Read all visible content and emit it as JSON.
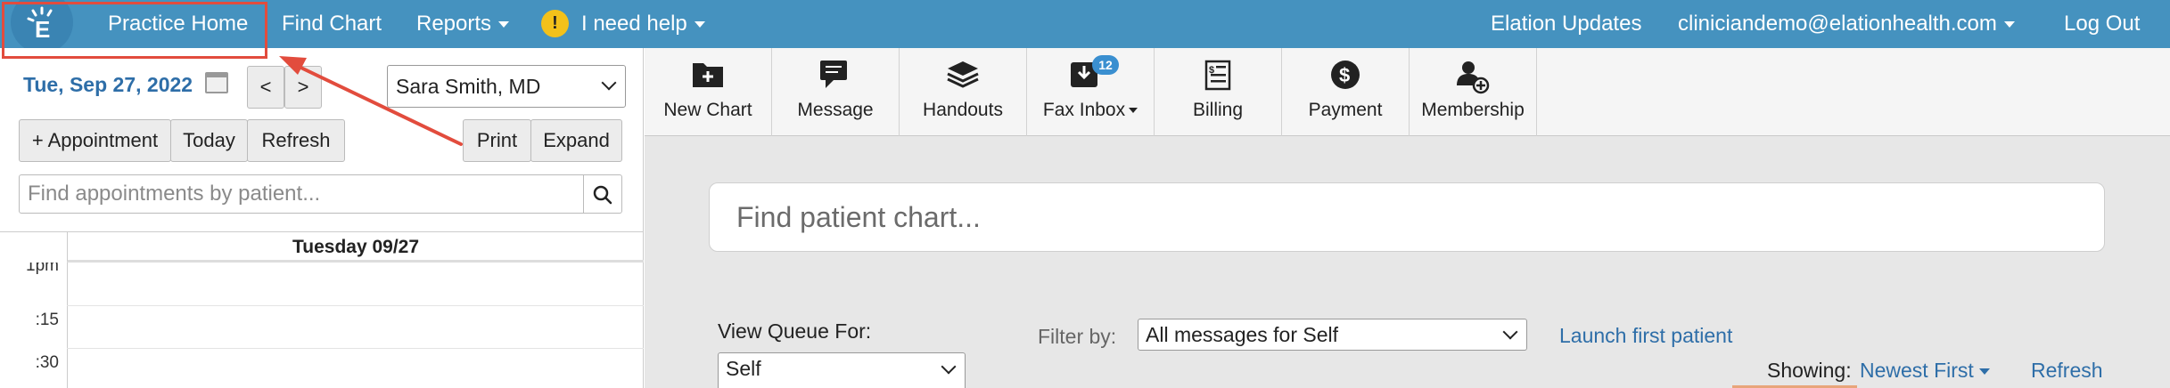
{
  "topnav": {
    "practice_home": "Practice Home",
    "find_chart": "Find Chart",
    "reports": "Reports",
    "help": "I need help",
    "updates": "Elation Updates",
    "user_email": "cliniciandemo@elationhealth.com",
    "logout": "Log Out"
  },
  "calendar": {
    "date": "Tue, Sep 27, 2022",
    "prev": "<",
    "next": ">",
    "provider": "Sara Smith, MD",
    "add_appointment": "+ Appointment",
    "today": "Today",
    "refresh": "Refresh",
    "print": "Print",
    "expand": "Expand",
    "search_placeholder": "Find appointments by patient...",
    "day_header": "Tuesday 09/27",
    "times": [
      "1pm",
      ":15",
      ":30"
    ]
  },
  "toolbar": {
    "new_chart": "New Chart",
    "message": "Message",
    "handouts": "Handouts",
    "fax_inbox": "Fax Inbox",
    "fax_count": "12",
    "billing": "Billing",
    "payment": "Payment",
    "membership": "Membership"
  },
  "main": {
    "chart_search_placeholder": "Find patient chart...",
    "view_queue_label": "View Queue For:",
    "view_queue_value": "Self",
    "filter_label": "Filter by:",
    "filter_value": "All messages for Self",
    "launch_first": "Launch first patient",
    "showing_label": "Showing:",
    "showing_value": "Newest First",
    "refresh": "Refresh"
  },
  "colors": {
    "nav": "#4592bf",
    "accent_blue": "#2e6ea8",
    "annotation": "#e24c3d",
    "help_icon": "#f3c11a"
  }
}
